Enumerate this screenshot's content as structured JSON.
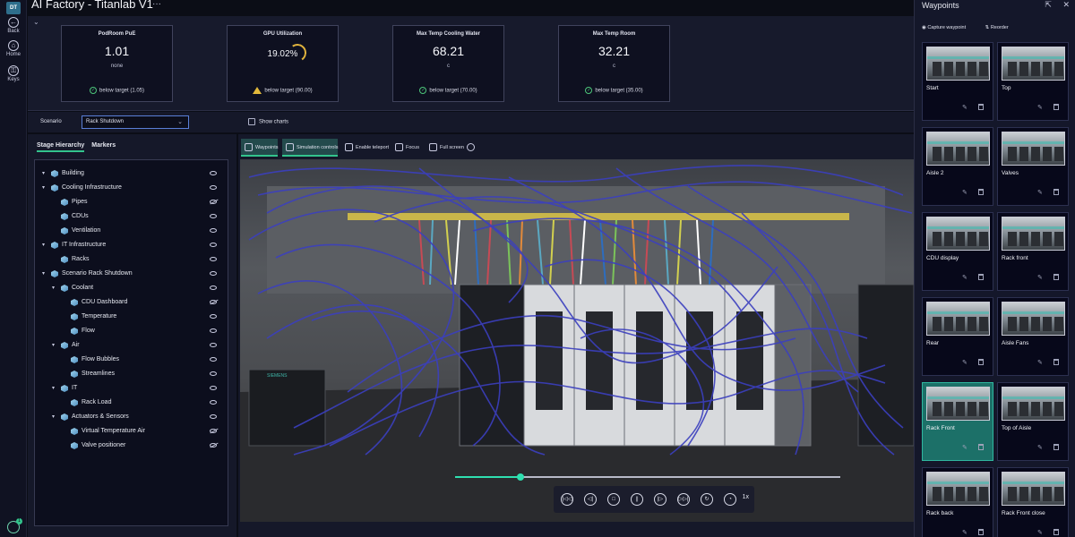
{
  "app": {
    "title": "AI Factory - Titanlab V1",
    "more": "···",
    "logo": "DT"
  },
  "rail": [
    {
      "label": "Back",
      "icon": "back-arrow-icon",
      "glyph": "←"
    },
    {
      "label": "Home",
      "icon": "home-icon",
      "glyph": "⌂"
    },
    {
      "label": "Keys",
      "icon": "keys-icon",
      "glyph": "⚿"
    }
  ],
  "notification_badge": "1",
  "kpis": [
    {
      "title": "PodRoom PuE",
      "value": "1.01",
      "unit": "none",
      "status": "below target (1.05)",
      "status_type": "ok"
    },
    {
      "title": "GPU Utilization",
      "value": "19.02%",
      "unit": "",
      "status": "below target (90.00)",
      "status_type": "warning",
      "gauge_level": 0.19
    },
    {
      "title": "Max Temp Cooling Water",
      "value": "68.21",
      "unit": "c",
      "status": "below target (70.00)",
      "status_type": "ok"
    },
    {
      "title": "Max Temp Room",
      "value": "32.21",
      "unit": "c",
      "status": "below target (35.00)",
      "status_type": "ok"
    }
  ],
  "scenario": {
    "label": "Scenario",
    "selected": "Rack Shutdown",
    "show_charts": "Show charts",
    "show_charts_checked": false
  },
  "stage": {
    "tabs": [
      "Stage Hierarchy",
      "Markers"
    ],
    "active_tab": "Stage Hierarchy",
    "tree": [
      {
        "label": "Building",
        "depth": 0,
        "expandable": true,
        "visible": true
      },
      {
        "label": "Cooling Infrastructure",
        "depth": 0,
        "expandable": true,
        "visible": true
      },
      {
        "label": "Pipes",
        "depth": 1,
        "expandable": false,
        "visible": false
      },
      {
        "label": "CDUs",
        "depth": 1,
        "expandable": false,
        "visible": true
      },
      {
        "label": "Ventilation",
        "depth": 1,
        "expandable": false,
        "visible": true
      },
      {
        "label": "IT Infrastructure",
        "depth": 0,
        "expandable": true,
        "visible": true
      },
      {
        "label": "Racks",
        "depth": 1,
        "expandable": false,
        "visible": true
      },
      {
        "label": "Scenario Rack Shutdown",
        "depth": 0,
        "expandable": true,
        "visible": true
      },
      {
        "label": "Coolant",
        "depth": 1,
        "expandable": true,
        "visible": true
      },
      {
        "label": "CDU Dashboard",
        "depth": 2,
        "expandable": false,
        "visible": false
      },
      {
        "label": "Temperature",
        "depth": 2,
        "expandable": false,
        "visible": true
      },
      {
        "label": "Flow",
        "depth": 2,
        "expandable": false,
        "visible": true
      },
      {
        "label": "Air",
        "depth": 1,
        "expandable": true,
        "visible": true
      },
      {
        "label": "Flow Bubbles",
        "depth": 2,
        "expandable": false,
        "visible": true
      },
      {
        "label": "Streamlines",
        "depth": 2,
        "expandable": false,
        "visible": true
      },
      {
        "label": "IT",
        "depth": 1,
        "expandable": true,
        "visible": true
      },
      {
        "label": "Rack Load",
        "depth": 2,
        "expandable": false,
        "visible": true
      },
      {
        "label": "Actuators & Sensors",
        "depth": 1,
        "expandable": true,
        "visible": true
      },
      {
        "label": "Virtual Temperature Air",
        "depth": 2,
        "expandable": false,
        "visible": false
      },
      {
        "label": "Valve positioner",
        "depth": 2,
        "expandable": false,
        "visible": false
      }
    ]
  },
  "viewer": {
    "toolbar": [
      {
        "label": "Waypoints",
        "icon": "map-pin-icon",
        "active": true
      },
      {
        "label": "Simulation controls",
        "icon": "sliders-icon",
        "active": true
      },
      {
        "label": "Enable teleport",
        "icon": "teleport-icon",
        "active": false
      },
      {
        "label": "Focus",
        "icon": "focus-icon",
        "active": false
      },
      {
        "label": "Full screen",
        "icon": "fullscreen-icon",
        "active": false
      },
      {
        "label": "",
        "icon": "info-icon",
        "active": false
      }
    ],
    "timeline_progress": 0.17,
    "playback": [
      "skip-start-icon",
      "step-back-icon",
      "stop-icon",
      "pause-icon",
      "step-forward-icon",
      "skip-end-icon",
      "loop-icon",
      "speed-gauge-icon"
    ],
    "playback_glyphs": [
      "|◁◁",
      "◁|",
      "□",
      "||",
      "|▷",
      "▷▷|",
      "↻",
      "◔"
    ],
    "speed": "1x",
    "brand_text": "SIEMENS"
  },
  "waypoints": {
    "title": "Waypoints",
    "header_icons": [
      "export-icon",
      "close-icon"
    ],
    "header_glyphs": [
      "⇱",
      "✕"
    ],
    "actions": [
      {
        "label": "Capture waypoint",
        "icon": "camera-icon"
      },
      {
        "label": "Reorder",
        "icon": "reorder-icon"
      }
    ],
    "items": [
      {
        "name": "Start",
        "active": false
      },
      {
        "name": "Top",
        "active": false
      },
      {
        "name": "Aisle 2",
        "active": false
      },
      {
        "name": "Valves",
        "active": false
      },
      {
        "name": "CDU display",
        "active": false
      },
      {
        "name": "Rack front",
        "active": false
      },
      {
        "name": "Rear",
        "active": false
      },
      {
        "name": "Aisle Fans",
        "active": false
      },
      {
        "name": "Rack Front",
        "active": true
      },
      {
        "name": "Top of Aisle",
        "active": false
      },
      {
        "name": "Rack back",
        "active": false
      },
      {
        "name": "Rack Front close",
        "active": false
      }
    ]
  },
  "colors": {
    "accent": "#33c48d",
    "active_card": "#1c7068",
    "streamline": "#3b3fbf",
    "warning": "#e2b93b"
  }
}
